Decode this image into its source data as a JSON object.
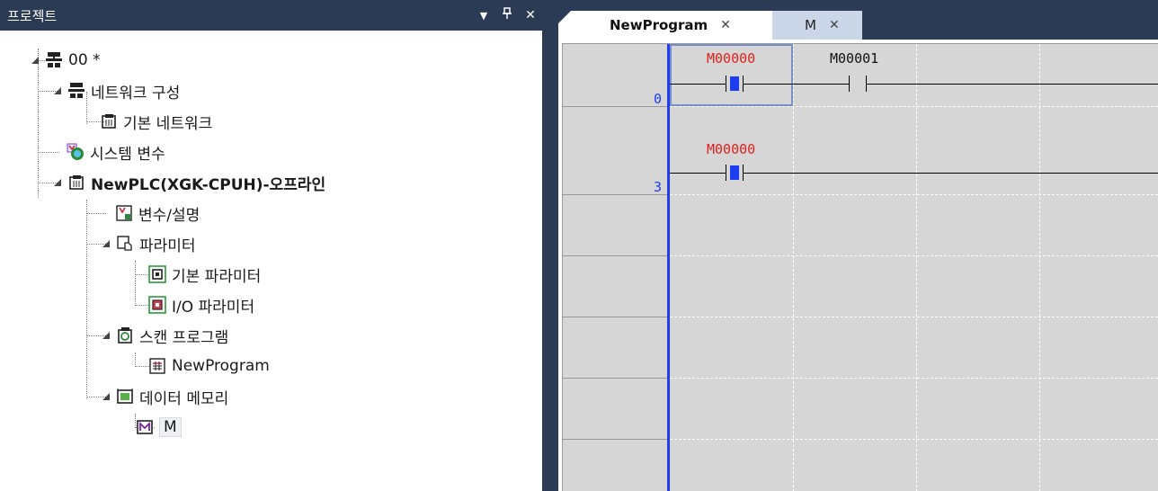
{
  "project_panel": {
    "title": "프로젝트",
    "pin_icon": "pin-icon",
    "close_icon": "close-icon",
    "dropdown_icon": "dropdown-icon",
    "tree": [
      {
        "label": "00 *",
        "icon": "project-network-icon",
        "bold": false
      },
      {
        "label": "네트워크 구성",
        "icon": "network-config-icon",
        "bold": false
      },
      {
        "label": "기본 네트워크",
        "icon": "basic-network-icon",
        "bold": false
      },
      {
        "label": "시스템 변수",
        "icon": "system-variable-icon",
        "bold": false
      },
      {
        "label": "NewPLC(XGK-CPUH)-오프라인",
        "icon": "plc-icon",
        "bold": true
      },
      {
        "label": "변수/설명",
        "icon": "variable-comment-icon",
        "bold": false
      },
      {
        "label": "파라미터",
        "icon": "parameter-icon",
        "bold": false
      },
      {
        "label": "기본 파라미터",
        "icon": "basic-parameter-icon",
        "bold": false
      },
      {
        "label": "I/O 파라미터",
        "icon": "io-parameter-icon",
        "bold": false
      },
      {
        "label": "스캔 프로그램",
        "icon": "scan-program-icon",
        "bold": false
      },
      {
        "label": "NewProgram",
        "icon": "program-icon",
        "bold": false
      },
      {
        "label": "데이터 메모리",
        "icon": "data-memory-icon",
        "bold": false
      },
      {
        "label": "M",
        "icon": "memory-m-icon",
        "bold": false
      }
    ]
  },
  "editor": {
    "tabs": [
      {
        "label": "NewProgram",
        "active": true,
        "close": "✕"
      },
      {
        "label": "M",
        "active": false,
        "close": "✕"
      }
    ],
    "rungs": [
      {
        "step": "0",
        "contacts": [
          {
            "device": "M00000",
            "state": "on"
          },
          {
            "device": "M00001",
            "state": "off"
          }
        ]
      },
      {
        "step": "3",
        "contacts": [
          {
            "device": "M00000",
            "state": "on"
          }
        ]
      }
    ]
  },
  "colors": {
    "frame": "#2b3a55",
    "ladder_bg": "#d6d6d6",
    "rail_blue": "#1e3cf0",
    "device_on": "#e0201c",
    "device_off": "#111111",
    "inactive_tab": "#cbd6e9"
  }
}
